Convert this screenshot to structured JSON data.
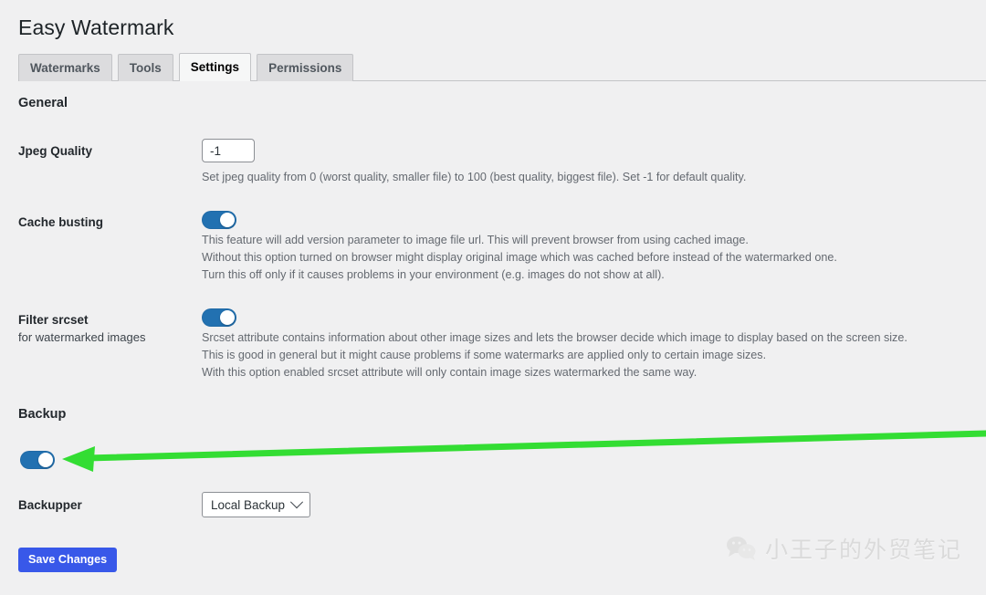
{
  "page": {
    "title": "Easy Watermark",
    "background_color": "#f0f0f1"
  },
  "tabs": [
    {
      "label": "Watermarks",
      "active": false
    },
    {
      "label": "Tools",
      "active": false
    },
    {
      "label": "Settings",
      "active": true
    },
    {
      "label": "Permissions",
      "active": false
    }
  ],
  "sections": {
    "general": {
      "heading": "General",
      "jpeg_quality": {
        "label": "Jpeg Quality",
        "value": "-1",
        "placeholder": "",
        "description": "Set jpeg quality from 0 (worst quality, smaller file) to 100 (best quality, biggest file). Set -1 for default quality."
      },
      "cache_busting": {
        "label": "Cache busting",
        "toggle_state": "on",
        "description_lines": [
          "This feature will add version parameter to image file url. This will prevent browser from using cached image.",
          "Without this option turned on browser might display original image which was cached before instead of the watermarked one.",
          "Turn this off only if it causes problems in your environment (e.g. images do not show at all)."
        ]
      },
      "filter_srcset": {
        "label": "Filter srcset",
        "sub_label": "for watermarked images",
        "toggle_state": "on",
        "description_lines": [
          "Srcset attribute contains information about other image sizes and lets the browser decide which image to display based on the screen size.",
          "This is good in general but it might cause problems if some watermarks are applied only to certain image sizes.",
          "With this option enabled srcset attribute will only contain image sizes watermarked the same way."
        ]
      }
    },
    "backup": {
      "heading": "Backup",
      "backup_toggle": {
        "label": "",
        "toggle_state": "on"
      },
      "backupper": {
        "label": "Backupper",
        "selected": "Local Backup"
      }
    }
  },
  "actions": {
    "save_label": "Save Changes",
    "save_color": "#3858e9"
  },
  "annotation": {
    "arrow_color": "#33dd33",
    "arrow_direction": "left"
  },
  "watermark": {
    "text": "小王子的外贸笔记",
    "icon": "wechat-icon"
  }
}
